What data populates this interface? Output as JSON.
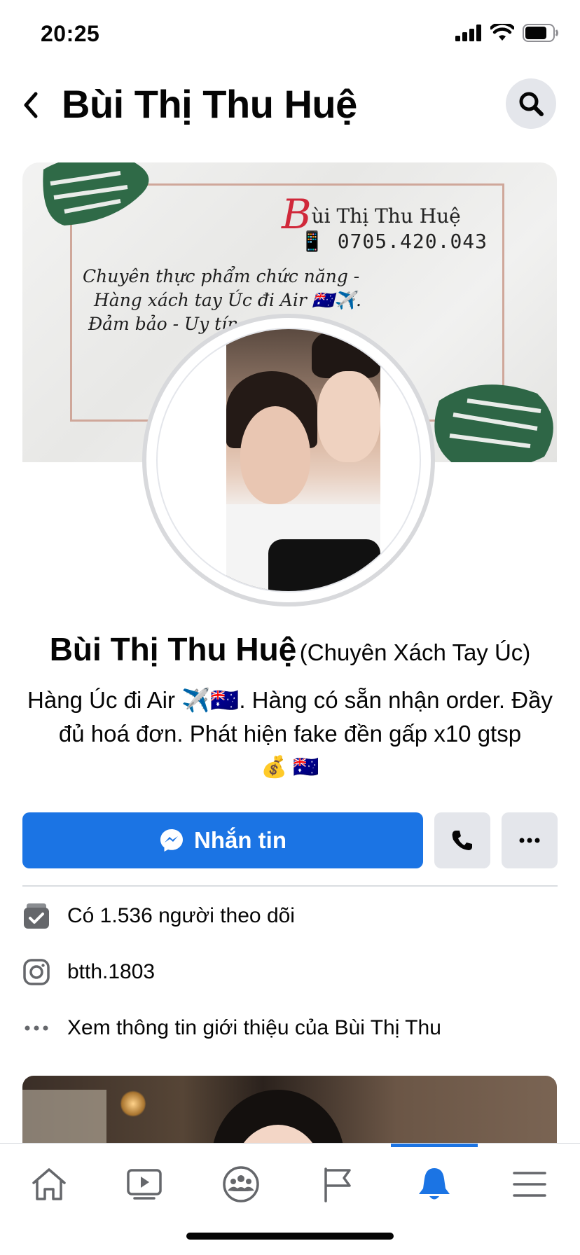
{
  "status_bar": {
    "time": "20:25"
  },
  "header": {
    "title": "Bùi Thị Thu Huệ"
  },
  "cover": {
    "signature_initial": "B",
    "signature_rest": "ùi Thị Thu Huệ",
    "phone": "📱 0705.420.043",
    "lines": [
      "Chuyên thực phẩm chức năng -",
      "Hàng xách tay Úc đi Air 🇦🇺✈️.",
      "Đảm bảo - Uy tín -"
    ]
  },
  "profile": {
    "name": "Bùi Thị Thu Huệ",
    "category": "(Chuyên Xách Tay Úc)",
    "bio": "Hàng Úc đi Air ✈️🇦🇺. Hàng có sẵn nhận order. Đầy đủ hoá đơn. Phát hiện fake đền gấp x10 gtsp",
    "bio_emoji": "💰 🇦🇺"
  },
  "actions": {
    "message_label": "Nhắn tin"
  },
  "info": {
    "followers": "Có 1.536 người theo dõi",
    "instagram": "btth.1803",
    "about": "Xem thông tin giới thiệu của Bùi Thị Thu"
  },
  "colors": {
    "accent": "#1b74e4",
    "button_gray": "#e4e6eb",
    "text": "#050505",
    "icon_gray": "#65676b"
  },
  "bottom_nav": {
    "items": [
      "home-icon",
      "video-icon",
      "groups-icon",
      "pages-flag-icon",
      "notifications-bell-icon",
      "menu-icon"
    ],
    "active": "notifications-bell-icon"
  }
}
